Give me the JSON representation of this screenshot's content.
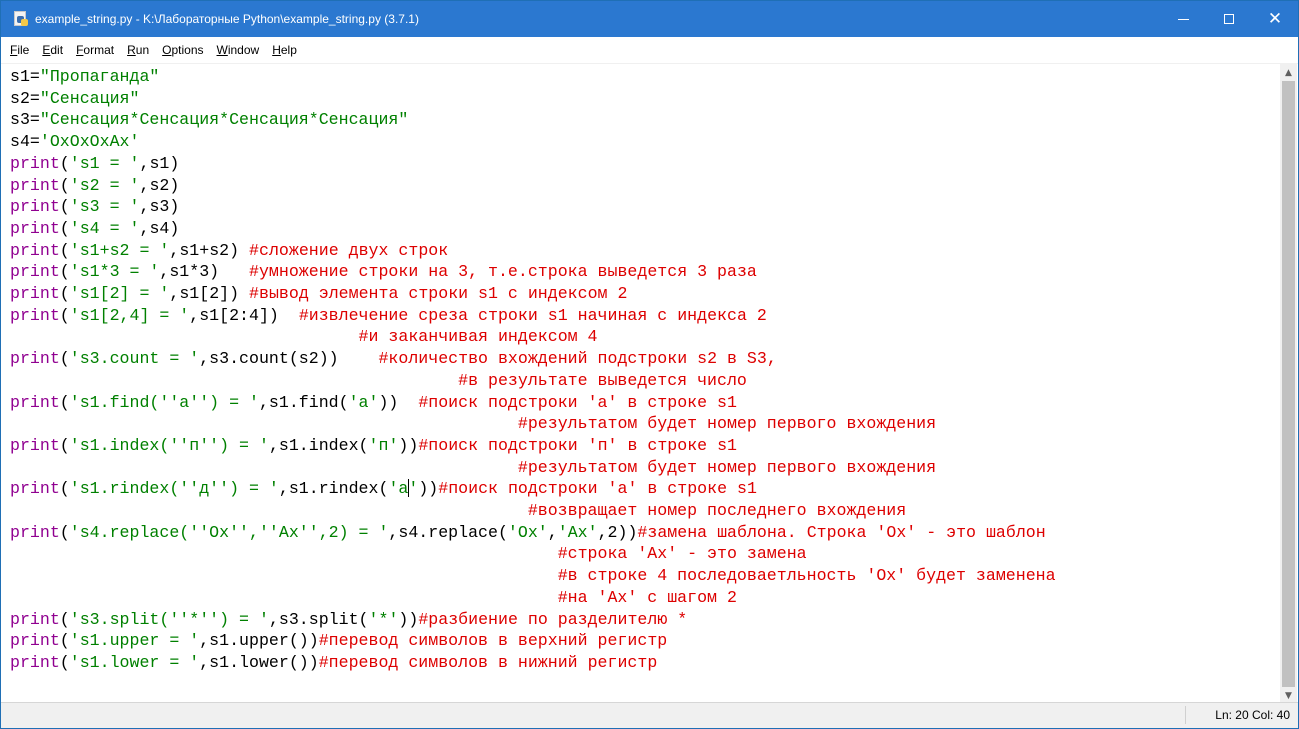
{
  "window": {
    "title": "example_string.py - K:\\Лабораторные Python\\example_string.py (3.7.1)",
    "app_icon": "python-file-icon",
    "controls": {
      "minimize": "minimize-icon",
      "maximize": "maximize-icon",
      "close": "✕"
    }
  },
  "menu": {
    "items": [
      {
        "mnemonic": "F",
        "rest": "ile"
      },
      {
        "mnemonic": "E",
        "rest": "dit"
      },
      {
        "mnemonic": "F",
        "rest": "ormat"
      },
      {
        "mnemonic": "R",
        "rest": "un"
      },
      {
        "mnemonic": "O",
        "rest": "ptions"
      },
      {
        "mnemonic": "W",
        "rest": "indow"
      },
      {
        "mnemonic": "H",
        "rest": "elp"
      }
    ]
  },
  "editor": {
    "lines": [
      [
        {
          "t": "tx",
          "v": "s1="
        },
        {
          "t": "str",
          "v": "\"Пропаганда\""
        }
      ],
      [
        {
          "t": "tx",
          "v": "s2="
        },
        {
          "t": "str",
          "v": "\"Сенсация\""
        }
      ],
      [
        {
          "t": "tx",
          "v": "s3="
        },
        {
          "t": "str",
          "v": "\"Сенсация*Сенсация*Сенсация*Сенсация\""
        }
      ],
      [
        {
          "t": "tx",
          "v": "s4="
        },
        {
          "t": "str",
          "v": "'OxOxOxAx'"
        }
      ],
      [
        {
          "t": "kw",
          "v": "print"
        },
        {
          "t": "tx",
          "v": "("
        },
        {
          "t": "str",
          "v": "'s1 = '"
        },
        {
          "t": "tx",
          "v": ",s1)"
        }
      ],
      [
        {
          "t": "kw",
          "v": "print"
        },
        {
          "t": "tx",
          "v": "("
        },
        {
          "t": "str",
          "v": "'s2 = '"
        },
        {
          "t": "tx",
          "v": ",s2)"
        }
      ],
      [
        {
          "t": "kw",
          "v": "print"
        },
        {
          "t": "tx",
          "v": "("
        },
        {
          "t": "str",
          "v": "'s3 = '"
        },
        {
          "t": "tx",
          "v": ",s3)"
        }
      ],
      [
        {
          "t": "kw",
          "v": "print"
        },
        {
          "t": "tx",
          "v": "("
        },
        {
          "t": "str",
          "v": "'s4 = '"
        },
        {
          "t": "tx",
          "v": ",s4)"
        }
      ],
      [
        {
          "t": "kw",
          "v": "print"
        },
        {
          "t": "tx",
          "v": "("
        },
        {
          "t": "str",
          "v": "'s1+s2 = '"
        },
        {
          "t": "tx",
          "v": ",s1+s2) "
        },
        {
          "t": "cm",
          "v": "#сложение двух строк"
        }
      ],
      [
        {
          "t": "kw",
          "v": "print"
        },
        {
          "t": "tx",
          "v": "("
        },
        {
          "t": "str",
          "v": "'s1*3 = '"
        },
        {
          "t": "tx",
          "v": ",s1*3)   "
        },
        {
          "t": "cm",
          "v": "#умножение строки на 3, т.е.строка выведется 3 раза"
        }
      ],
      [
        {
          "t": "kw",
          "v": "print"
        },
        {
          "t": "tx",
          "v": "("
        },
        {
          "t": "str",
          "v": "'s1[2] = '"
        },
        {
          "t": "tx",
          "v": ",s1[2]) "
        },
        {
          "t": "cm",
          "v": "#вывод элемента строки s1 с индексом 2"
        }
      ],
      [
        {
          "t": "kw",
          "v": "print"
        },
        {
          "t": "tx",
          "v": "("
        },
        {
          "t": "str",
          "v": "'s1[2,4] = '"
        },
        {
          "t": "tx",
          "v": ",s1[2:4])  "
        },
        {
          "t": "cm",
          "v": "#извлечение среза строки s1 начиная с индекса 2"
        }
      ],
      [
        {
          "t": "tx",
          "v": "                                   "
        },
        {
          "t": "cm",
          "v": "#и заканчивая индексом 4"
        }
      ],
      [
        {
          "t": "kw",
          "v": "print"
        },
        {
          "t": "tx",
          "v": "("
        },
        {
          "t": "str",
          "v": "'s3.count = '"
        },
        {
          "t": "tx",
          "v": ",s3.count(s2))    "
        },
        {
          "t": "cm",
          "v": "#количество вхождений подстроки s2 в S3,"
        }
      ],
      [
        {
          "t": "tx",
          "v": "                                             "
        },
        {
          "t": "cm",
          "v": "#в результате выведется число"
        }
      ],
      [
        {
          "t": "kw",
          "v": "print"
        },
        {
          "t": "tx",
          "v": "("
        },
        {
          "t": "str",
          "v": "'s1.find(''a'') = '"
        },
        {
          "t": "tx",
          "v": ",s1.find("
        },
        {
          "t": "str",
          "v": "'a'"
        },
        {
          "t": "tx",
          "v": "))  "
        },
        {
          "t": "cm",
          "v": "#поиск подстроки 'а' в строке s1"
        }
      ],
      [
        {
          "t": "tx",
          "v": "                                                   "
        },
        {
          "t": "cm",
          "v": "#результатом будет номер первого вхождения"
        }
      ],
      [
        {
          "t": "kw",
          "v": "print"
        },
        {
          "t": "tx",
          "v": "("
        },
        {
          "t": "str",
          "v": "'s1.index(''п'') = '"
        },
        {
          "t": "tx",
          "v": ",s1.index("
        },
        {
          "t": "str",
          "v": "'п'"
        },
        {
          "t": "tx",
          "v": "))"
        },
        {
          "t": "cm",
          "v": "#поиск подстроки 'п' в строке s1"
        }
      ],
      [
        {
          "t": "tx",
          "v": "                                                   "
        },
        {
          "t": "cm",
          "v": "#результатом будет номер первого вхождения"
        }
      ],
      [
        {
          "t": "kw",
          "v": "print"
        },
        {
          "t": "tx",
          "v": "("
        },
        {
          "t": "str",
          "v": "'s1.rindex(''д'') = '"
        },
        {
          "t": "tx",
          "v": ",s1.rindex("
        },
        {
          "t": "str",
          "v": "'а"
        },
        {
          "t": "caret",
          "v": ""
        },
        {
          "t": "str",
          "v": "'"
        },
        {
          "t": "tx",
          "v": "))"
        },
        {
          "t": "cm",
          "v": "#поиск подстроки 'а' в строке s1"
        }
      ],
      [
        {
          "t": "tx",
          "v": "                                                    "
        },
        {
          "t": "cm",
          "v": "#возвращает номер последнего вхождения"
        }
      ],
      [
        {
          "t": "kw",
          "v": "print"
        },
        {
          "t": "tx",
          "v": "("
        },
        {
          "t": "str",
          "v": "'s4.replace(''Ox'',''Ax'',2) = '"
        },
        {
          "t": "tx",
          "v": ",s4.replace("
        },
        {
          "t": "str",
          "v": "'Ox'"
        },
        {
          "t": "tx",
          "v": ","
        },
        {
          "t": "str",
          "v": "'Ax'"
        },
        {
          "t": "tx",
          "v": ",2))"
        },
        {
          "t": "cm",
          "v": "#замена шаблона. Строка 'Ox' - это шаблон"
        }
      ],
      [
        {
          "t": "tx",
          "v": "                                                       "
        },
        {
          "t": "cm",
          "v": "#строка 'Ax' - это замена"
        }
      ],
      [
        {
          "t": "tx",
          "v": "                                                       "
        },
        {
          "t": "cm",
          "v": "#в строке 4 последоваетльность 'Ox' будет заменена"
        }
      ],
      [
        {
          "t": "tx",
          "v": "                                                       "
        },
        {
          "t": "cm",
          "v": "#на 'Ax' с шагом 2"
        }
      ],
      [
        {
          "t": "kw",
          "v": "print"
        },
        {
          "t": "tx",
          "v": "("
        },
        {
          "t": "str",
          "v": "'s3.split(''*'') = '"
        },
        {
          "t": "tx",
          "v": ",s3.split("
        },
        {
          "t": "str",
          "v": "'*'"
        },
        {
          "t": "tx",
          "v": "))"
        },
        {
          "t": "cm",
          "v": "#разбиение по разделителю *"
        }
      ],
      [
        {
          "t": "kw",
          "v": "print"
        },
        {
          "t": "tx",
          "v": "("
        },
        {
          "t": "str",
          "v": "'s1.upper = '"
        },
        {
          "t": "tx",
          "v": ",s1.upper())"
        },
        {
          "t": "cm",
          "v": "#перевод символов в верхний регистр"
        }
      ],
      [
        {
          "t": "kw",
          "v": "print"
        },
        {
          "t": "tx",
          "v": "("
        },
        {
          "t": "str",
          "v": "'s1.lower = '"
        },
        {
          "t": "tx",
          "v": ",s1.lower())"
        },
        {
          "t": "cm",
          "v": "#перевод символов в нижний регистр"
        }
      ]
    ]
  },
  "scrollbar": {
    "up_icon": "▲",
    "down_icon": "▼"
  },
  "status": {
    "position": "Ln: 20  Col: 40"
  },
  "colors": {
    "titlebar": "#2b78d0",
    "keyword": "#900090",
    "string": "#008000",
    "comment": "#dd0000",
    "text": "#000000"
  }
}
